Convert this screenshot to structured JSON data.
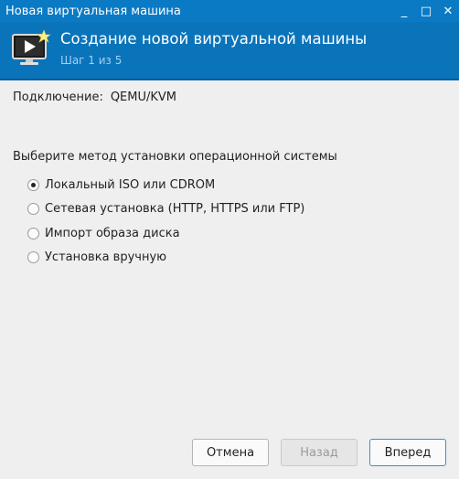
{
  "window": {
    "title": "Новая виртуальная машина",
    "buttons": [
      {
        "name": "minimize",
        "glyph": "_"
      },
      {
        "name": "maximize",
        "glyph": "□"
      },
      {
        "name": "close",
        "glyph": "✕"
      }
    ]
  },
  "header": {
    "title": "Создание новой виртуальной машины",
    "step": "Шаг 1 из 5",
    "icon": "virtual-machine-icon"
  },
  "connection": {
    "label": "Подключение:",
    "value": "QEMU/KVM"
  },
  "install_method": {
    "label": "Выберите метод установки операционной системы",
    "options": [
      {
        "label": "Локальный ISO или CDROM",
        "checked": true
      },
      {
        "label": "Сетевая установка (HTTP, HTTPS или FTP)",
        "checked": false
      },
      {
        "label": "Импорт образа диска",
        "checked": false
      },
      {
        "label": "Установка вручную",
        "checked": false
      }
    ]
  },
  "footer": {
    "cancel": "Отмена",
    "back": "Назад",
    "next": "Вперед"
  },
  "colors": {
    "titlebar": "#0a7ac5",
    "header": "#0a74bb",
    "step_text": "#9fd0f2"
  }
}
